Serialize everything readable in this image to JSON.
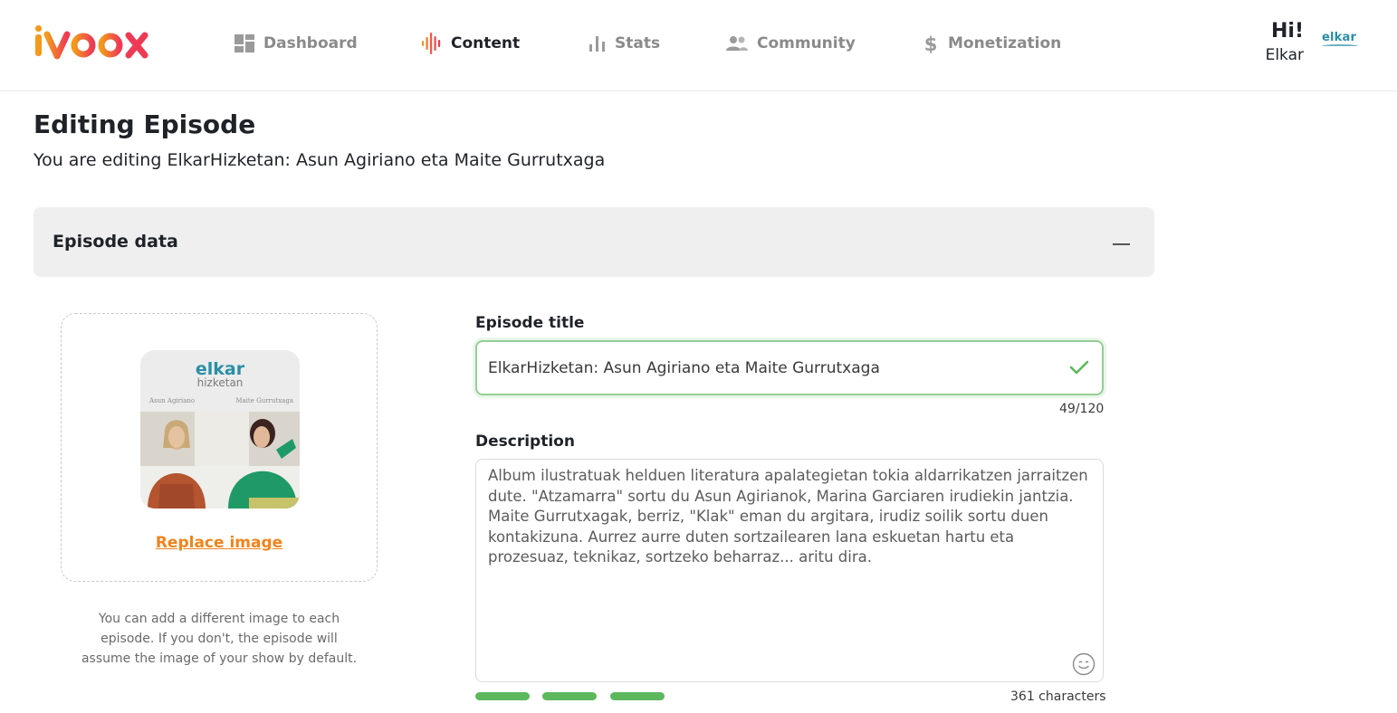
{
  "header": {
    "brand": "ivoox",
    "nav": [
      {
        "label": "Dashboard",
        "icon": "dashboard-icon"
      },
      {
        "label": "Content",
        "icon": "waveform-icon",
        "active": true
      },
      {
        "label": "Stats",
        "icon": "bar-chart-icon"
      },
      {
        "label": "Community",
        "icon": "people-icon"
      },
      {
        "label": "Monetization",
        "icon": "dollar-icon"
      }
    ],
    "greeting": "Hi!",
    "username": "Elkar",
    "avatar_text": "elkar"
  },
  "page": {
    "title": "Editing Episode",
    "subtitle": "You are editing ElkarHizketan: Asun Agiriano eta Maite Gurrutxaga"
  },
  "section": {
    "label": "Episode data"
  },
  "image_panel": {
    "cover": {
      "brand": "elkar",
      "brand_sub": "hizketan",
      "name_left": "Asun Agiriano",
      "name_right": "Maite Gurrutxaga"
    },
    "replace_label": "Replace image",
    "help": "You can add a different image to each episode. If you don't, the episode will assume the image of your show by default."
  },
  "form": {
    "title_label": "Episode title",
    "title_value": "ElkarHizketan: Asun Agiriano eta Maite Gurrutxaga",
    "title_counter": "49/120",
    "description_label": "Description",
    "description_value": "Album ilustratuak helduen literatura apalategietan tokia aldarrikatzen jarraitzen dute. \"Atzamarra\" sortu du Asun Agirianok, Marina Garciaren irudiekin jantzia. Maite Gurrutxagak, berriz, \"Klak\" eman du argitara, irudiz soilik sortu duen kontakizuna. Aurrez aurre duten sortzailearen lana eskuetan hartu eta prozesuaz, teknikaz, sortzeko beharraz... aritu dira.",
    "description_counter": "361 characters",
    "strength_segments": 3
  },
  "colors": {
    "brand_orange": "#f0841b",
    "brand_red": "#ee3a55",
    "success_green": "#5cb85c",
    "elkar_teal": "#2a8fa6"
  }
}
